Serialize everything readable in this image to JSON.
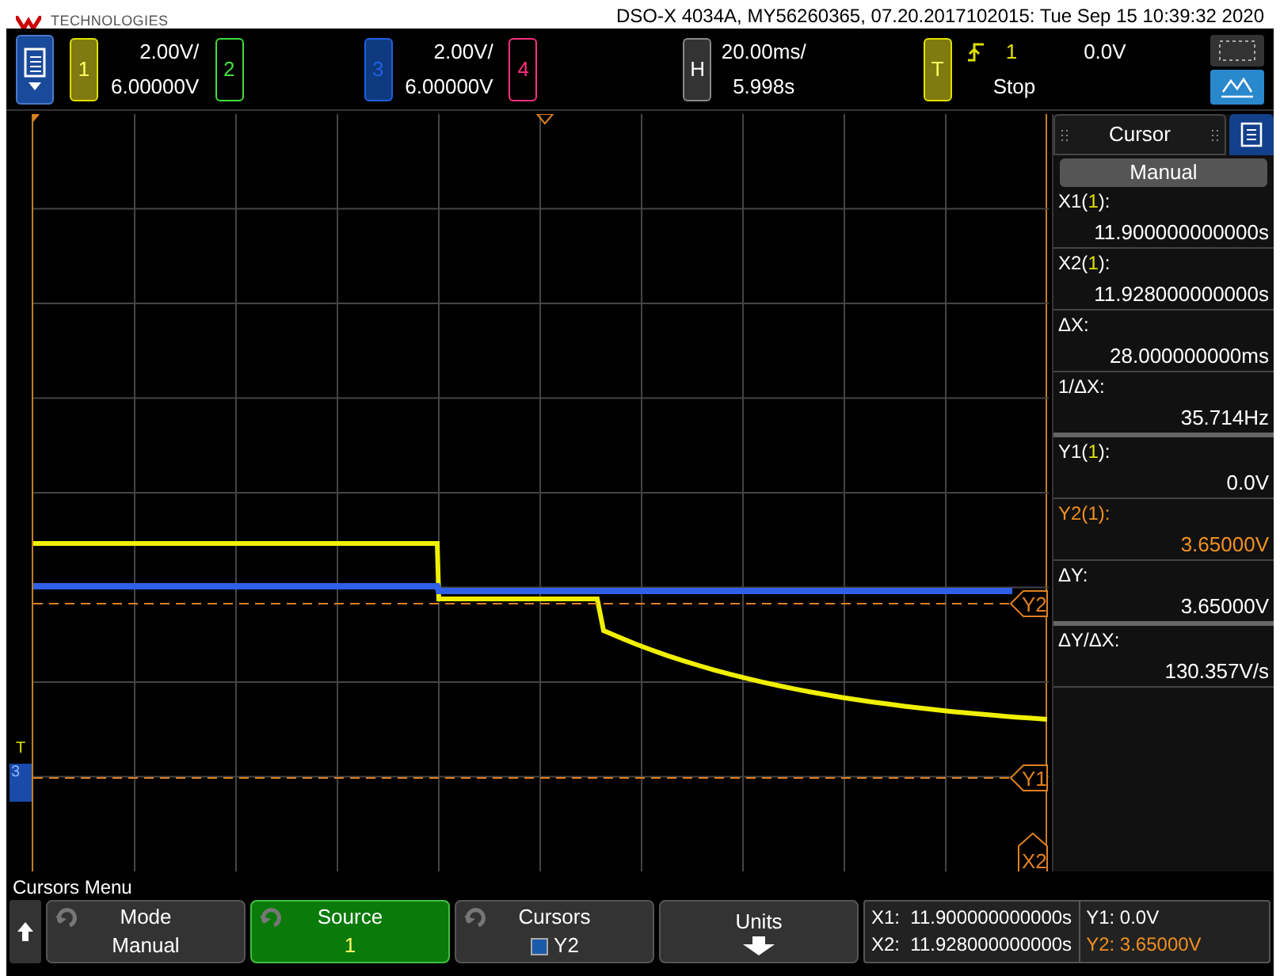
{
  "header": {
    "logo": "TECHNOLOGIES",
    "title": "DSO-X 4034A, MY56260365, 07.20.2017102015: Tue Sep 15 10:39:32 2020"
  },
  "channels": [
    {
      "number": "1",
      "on": true,
      "color": "#e0e000",
      "scale": "2.00V/",
      "offset": "6.00000V"
    },
    {
      "number": "2",
      "on": false,
      "color": "#40e040"
    },
    {
      "number": "3",
      "on": true,
      "color": "#2060e0",
      "scale": "2.00V/",
      "offset": "6.00000V"
    },
    {
      "number": "4",
      "on": false,
      "color": "#ff3080"
    }
  ],
  "horizontal": {
    "key": "H",
    "scale": "20.00ms/",
    "delay": "5.998s"
  },
  "trigger": {
    "key": "T",
    "source": "1",
    "level": "0.0V",
    "state": "Stop"
  },
  "scope_cursors": [
    {
      "kind": "y",
      "label": "Y2"
    },
    {
      "kind": "y",
      "label": "Y1"
    },
    {
      "kind": "x",
      "label": "X2"
    }
  ],
  "ground_marker": {
    "label": "3"
  },
  "trigger_marker": {
    "label": "T"
  },
  "cursor_panel": {
    "title": "Cursor",
    "mode": "Manual",
    "items": [
      {
        "label": [
          "X1(",
          "1",
          "):"
        ],
        "value": "11.900000000000s",
        "active": false
      },
      {
        "label": [
          "X2(",
          "1",
          "):"
        ],
        "value": "11.928000000000s",
        "active": false
      },
      {
        "label": [
          "ΔX:"
        ],
        "value": "28.000000000ms",
        "active": false
      },
      {
        "label": [
          "1/ΔX:"
        ],
        "value": "35.714Hz",
        "active": false
      },
      {
        "label": [
          "Y1(",
          "1",
          "):"
        ],
        "value": "0.0V",
        "active": false
      },
      {
        "label": [
          "Y2(",
          "1",
          "):"
        ],
        "value": "3.65000V",
        "active": true
      },
      {
        "label": [
          "ΔY:"
        ],
        "value": "3.65000V",
        "active": false
      },
      {
        "label": [
          "ΔY/ΔX:"
        ],
        "value": "130.357V/s",
        "active": false
      }
    ]
  },
  "menu": {
    "title": "Cursors Menu",
    "softkeys": [
      {
        "kind": "knob",
        "label": "Mode",
        "value": "Manual",
        "selected": false
      },
      {
        "kind": "knob",
        "label": "Source",
        "value": "1",
        "selected": true
      },
      {
        "kind": "check",
        "label": "Cursors",
        "value": "Y2",
        "selected": false
      },
      {
        "kind": "arrow",
        "label": "Units",
        "selected": false
      }
    ],
    "readouts": [
      {
        "text": "X1:  11.900000000000s",
        "active": false
      },
      {
        "text": "X2:  11.928000000000s",
        "active": false
      }
    ],
    "readouts_y": [
      {
        "text": "Y1: 0.0V",
        "active": false
      },
      {
        "text": "Y2: 3.65000V",
        "active": true
      }
    ]
  }
}
